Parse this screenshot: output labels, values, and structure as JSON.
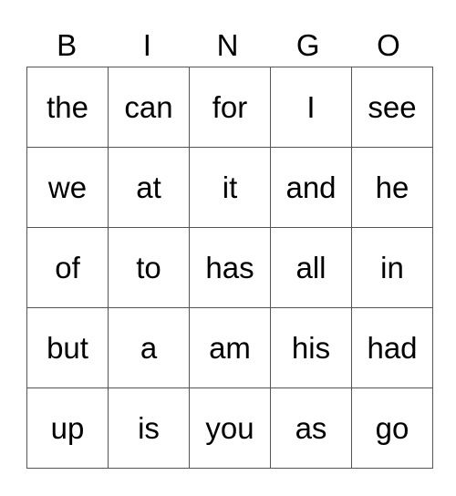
{
  "header": [
    "B",
    "I",
    "N",
    "G",
    "O"
  ],
  "rows": [
    [
      "the",
      "can",
      "for",
      "I",
      "see"
    ],
    [
      "we",
      "at",
      "it",
      "and",
      "he"
    ],
    [
      "of",
      "to",
      "has",
      "all",
      "in"
    ],
    [
      "but",
      "a",
      "am",
      "his",
      "had"
    ],
    [
      "up",
      "is",
      "you",
      "as",
      "go"
    ]
  ]
}
